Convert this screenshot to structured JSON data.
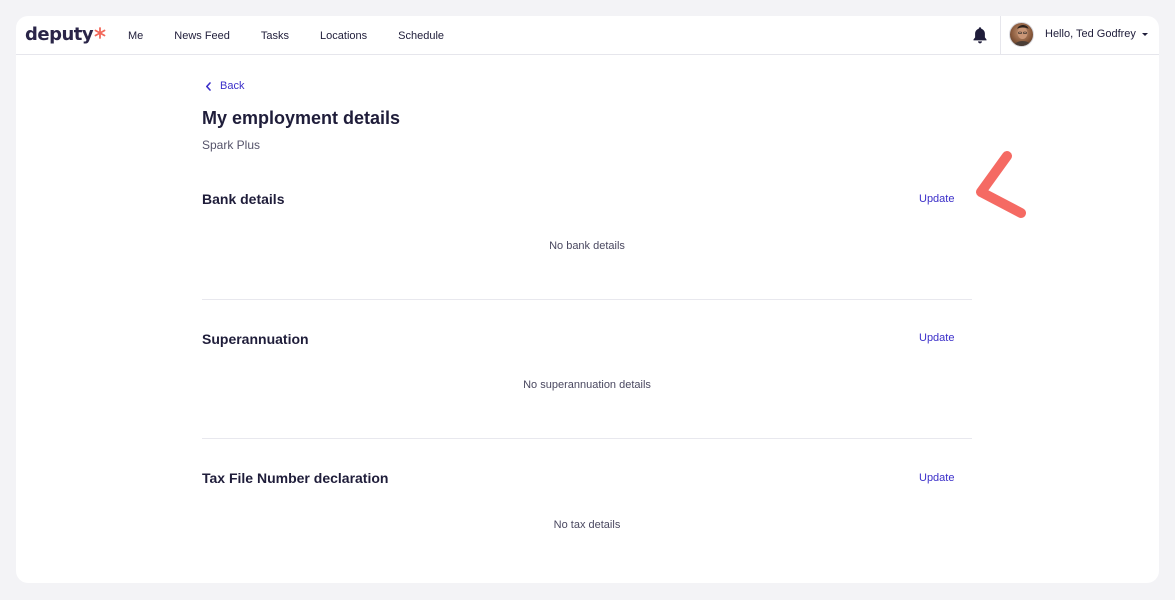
{
  "nav": {
    "logo_text": "deputy",
    "items": [
      "Me",
      "News Feed",
      "Tasks",
      "Locations",
      "Schedule"
    ],
    "user_greeting": "Hello, Ted Godfrey"
  },
  "page": {
    "back_label": "Back",
    "title": "My employment details",
    "subtitle": "Spark Plus"
  },
  "sections": [
    {
      "title": "Bank details",
      "action": "Update",
      "empty": "No bank details"
    },
    {
      "title": "Superannuation",
      "action": "Update",
      "empty": "No superannuation details"
    },
    {
      "title": "Tax File Number declaration",
      "action": "Update",
      "empty": "No tax details"
    }
  ],
  "colors": {
    "accent": "#3b2fc9",
    "logo_mark": "#f2685a",
    "annotation": "#f56a63",
    "text": "#1f1d3a"
  },
  "icons": {
    "bell": "bell-icon",
    "back": "chevron-left-icon",
    "caret": "caret-down-icon"
  }
}
